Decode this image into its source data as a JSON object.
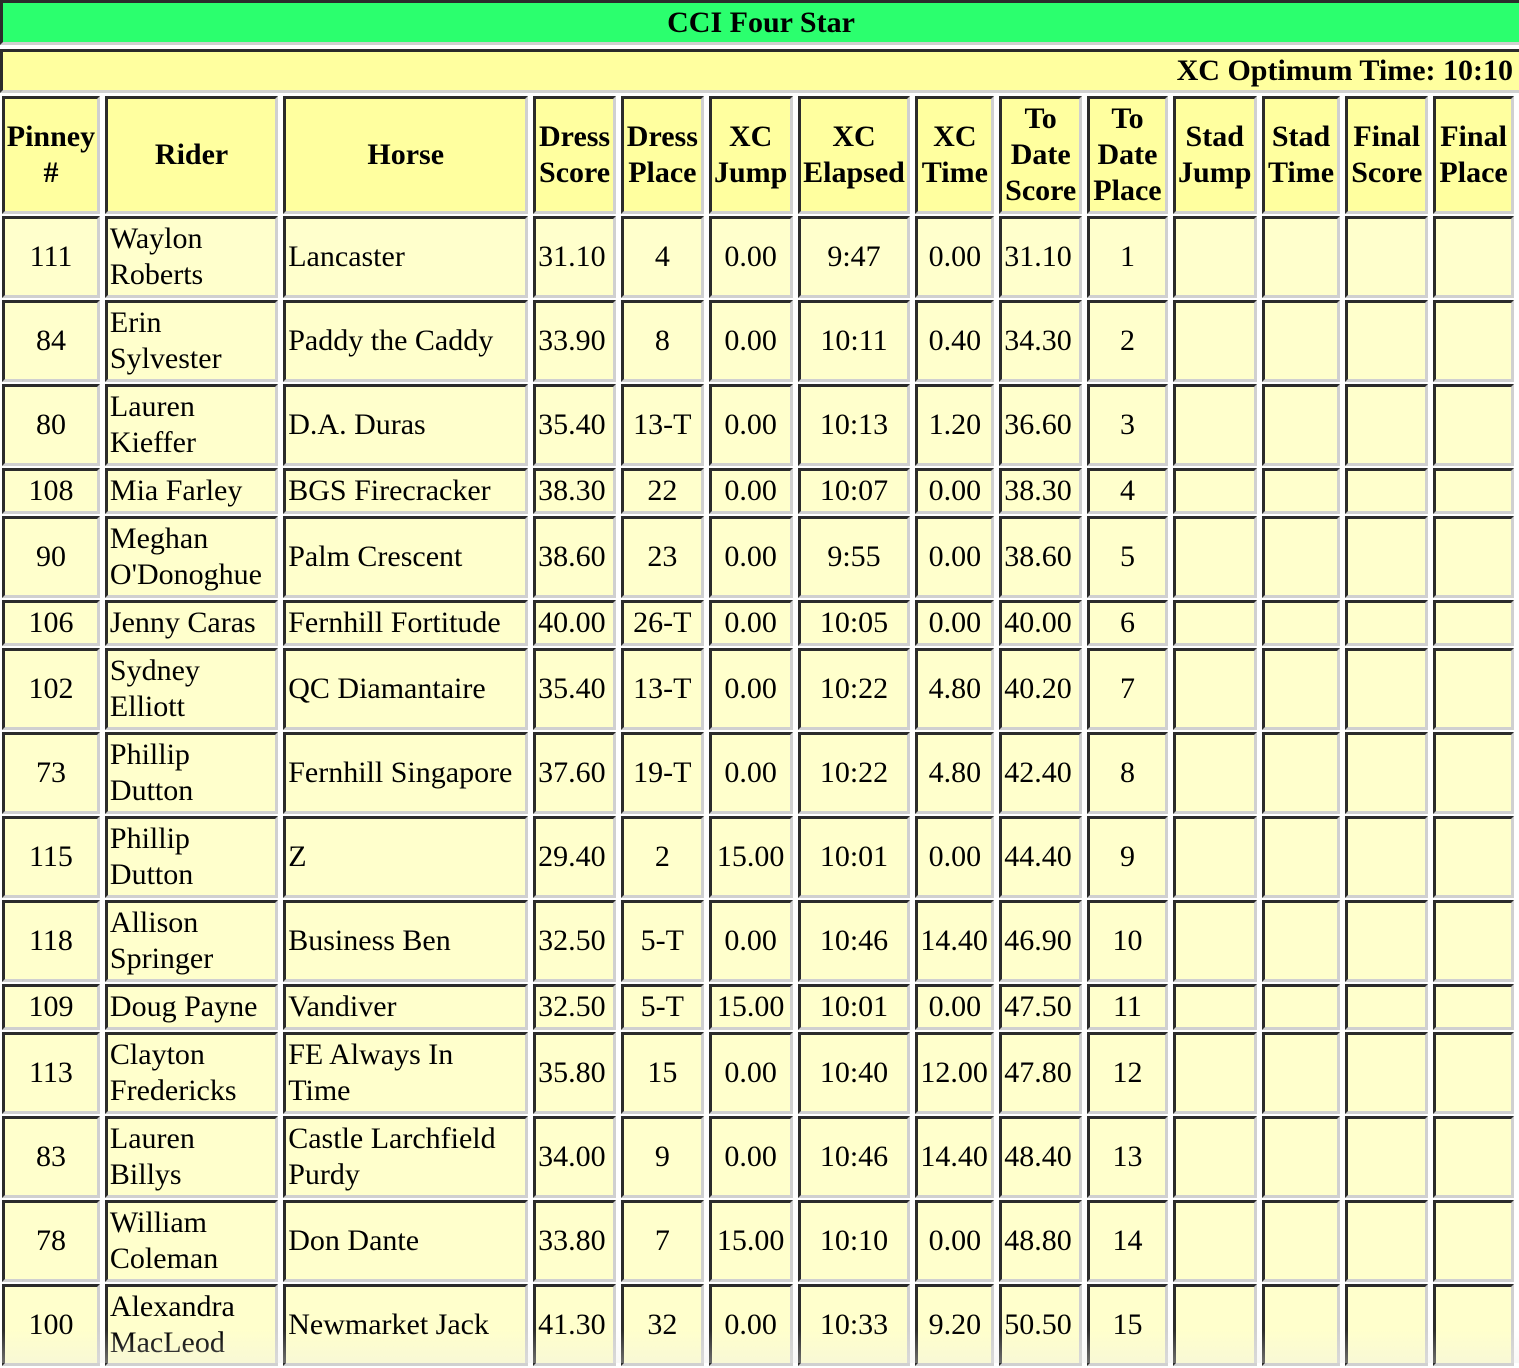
{
  "header": {
    "title": "CCI Four Star",
    "xc_optimum_time_label": "XC Optimum Time: 10:10"
  },
  "colors": {
    "title_bar": "#2bff6e",
    "header_cell": "#ffff9f",
    "data_cell": "#ffffcc"
  },
  "table": {
    "columns": [
      [
        "Pinney",
        "#"
      ],
      [
        "Rider"
      ],
      [
        "Horse"
      ],
      [
        "Dress",
        "Score"
      ],
      [
        "Dress",
        "Place"
      ],
      [
        "XC",
        "Jump"
      ],
      [
        "XC",
        "Elapsed"
      ],
      [
        "XC",
        "Time"
      ],
      [
        "To",
        "Date",
        "Score"
      ],
      [
        "To",
        "Date",
        "Place"
      ],
      [
        "Stad",
        "Jump"
      ],
      [
        "Stad",
        "Time"
      ],
      [
        "Final",
        "Score"
      ],
      [
        "Final",
        "Place"
      ]
    ],
    "rows": [
      {
        "pinney": "111",
        "rider": [
          "Waylon",
          "Roberts"
        ],
        "horse": [
          "Lancaster"
        ],
        "dress_score": "31.10",
        "dress_place": "4",
        "xc_jump": "0.00",
        "xc_elapsed": "9:47",
        "xc_time": "0.00",
        "to_date_score": "31.10",
        "to_date_place": "1",
        "stad_jump": "",
        "stad_time": "",
        "final_score": "",
        "final_place": ""
      },
      {
        "pinney": "84",
        "rider": [
          "Erin",
          "Sylvester"
        ],
        "horse": [
          "Paddy the Caddy"
        ],
        "dress_score": "33.90",
        "dress_place": "8",
        "xc_jump": "0.00",
        "xc_elapsed": "10:11",
        "xc_time": "0.40",
        "to_date_score": "34.30",
        "to_date_place": "2",
        "stad_jump": "",
        "stad_time": "",
        "final_score": "",
        "final_place": ""
      },
      {
        "pinney": "80",
        "rider": [
          "Lauren",
          "Kieffer"
        ],
        "horse": [
          "D.A. Duras"
        ],
        "dress_score": "35.40",
        "dress_place": "13-T",
        "xc_jump": "0.00",
        "xc_elapsed": "10:13",
        "xc_time": "1.20",
        "to_date_score": "36.60",
        "to_date_place": "3",
        "stad_jump": "",
        "stad_time": "",
        "final_score": "",
        "final_place": ""
      },
      {
        "pinney": "108",
        "rider": [
          "Mia Farley"
        ],
        "horse": [
          "BGS Firecracker"
        ],
        "dress_score": "38.30",
        "dress_place": "22",
        "xc_jump": "0.00",
        "xc_elapsed": "10:07",
        "xc_time": "0.00",
        "to_date_score": "38.30",
        "to_date_place": "4",
        "stad_jump": "",
        "stad_time": "",
        "final_score": "",
        "final_place": ""
      },
      {
        "pinney": "90",
        "rider": [
          "Meghan",
          "O'Donoghue"
        ],
        "horse": [
          "Palm Crescent"
        ],
        "dress_score": "38.60",
        "dress_place": "23",
        "xc_jump": "0.00",
        "xc_elapsed": "9:55",
        "xc_time": "0.00",
        "to_date_score": "38.60",
        "to_date_place": "5",
        "stad_jump": "",
        "stad_time": "",
        "final_score": "",
        "final_place": ""
      },
      {
        "pinney": "106",
        "rider": [
          "Jenny Caras"
        ],
        "horse": [
          "Fernhill Fortitude"
        ],
        "dress_score": "40.00",
        "dress_place": "26-T",
        "xc_jump": "0.00",
        "xc_elapsed": "10:05",
        "xc_time": "0.00",
        "to_date_score": "40.00",
        "to_date_place": "6",
        "stad_jump": "",
        "stad_time": "",
        "final_score": "",
        "final_place": ""
      },
      {
        "pinney": "102",
        "rider": [
          "Sydney",
          "Elliott"
        ],
        "horse": [
          "QC Diamantaire"
        ],
        "dress_score": "35.40",
        "dress_place": "13-T",
        "xc_jump": "0.00",
        "xc_elapsed": "10:22",
        "xc_time": "4.80",
        "to_date_score": "40.20",
        "to_date_place": "7",
        "stad_jump": "",
        "stad_time": "",
        "final_score": "",
        "final_place": ""
      },
      {
        "pinney": "73",
        "rider": [
          "Phillip",
          "Dutton"
        ],
        "horse": [
          "Fernhill Singapore"
        ],
        "dress_score": "37.60",
        "dress_place": "19-T",
        "xc_jump": "0.00",
        "xc_elapsed": "10:22",
        "xc_time": "4.80",
        "to_date_score": "42.40",
        "to_date_place": "8",
        "stad_jump": "",
        "stad_time": "",
        "final_score": "",
        "final_place": ""
      },
      {
        "pinney": "115",
        "rider": [
          "Phillip",
          "Dutton"
        ],
        "horse": [
          "Z"
        ],
        "dress_score": "29.40",
        "dress_place": "2",
        "xc_jump": "15.00",
        "xc_elapsed": "10:01",
        "xc_time": "0.00",
        "to_date_score": "44.40",
        "to_date_place": "9",
        "stad_jump": "",
        "stad_time": "",
        "final_score": "",
        "final_place": ""
      },
      {
        "pinney": "118",
        "rider": [
          "Allison",
          "Springer"
        ],
        "horse": [
          "Business Ben"
        ],
        "dress_score": "32.50",
        "dress_place": "5-T",
        "xc_jump": "0.00",
        "xc_elapsed": "10:46",
        "xc_time": "14.40",
        "to_date_score": "46.90",
        "to_date_place": "10",
        "stad_jump": "",
        "stad_time": "",
        "final_score": "",
        "final_place": ""
      },
      {
        "pinney": "109",
        "rider": [
          "Doug Payne"
        ],
        "horse": [
          "Vandiver"
        ],
        "dress_score": "32.50",
        "dress_place": "5-T",
        "xc_jump": "15.00",
        "xc_elapsed": "10:01",
        "xc_time": "0.00",
        "to_date_score": "47.50",
        "to_date_place": "11",
        "stad_jump": "",
        "stad_time": "",
        "final_score": "",
        "final_place": ""
      },
      {
        "pinney": "113",
        "rider": [
          "Clayton",
          "Fredericks"
        ],
        "horse": [
          "FE Always In",
          "Time"
        ],
        "dress_score": "35.80",
        "dress_place": "15",
        "xc_jump": "0.00",
        "xc_elapsed": "10:40",
        "xc_time": "12.00",
        "to_date_score": "47.80",
        "to_date_place": "12",
        "stad_jump": "",
        "stad_time": "",
        "final_score": "",
        "final_place": ""
      },
      {
        "pinney": "83",
        "rider": [
          "Lauren",
          "Billys"
        ],
        "horse": [
          "Castle Larchfield",
          "Purdy"
        ],
        "dress_score": "34.00",
        "dress_place": "9",
        "xc_jump": "0.00",
        "xc_elapsed": "10:46",
        "xc_time": "14.40",
        "to_date_score": "48.40",
        "to_date_place": "13",
        "stad_jump": "",
        "stad_time": "",
        "final_score": "",
        "final_place": ""
      },
      {
        "pinney": "78",
        "rider": [
          "William",
          "Coleman"
        ],
        "horse": [
          "Don Dante"
        ],
        "dress_score": "33.80",
        "dress_place": "7",
        "xc_jump": "15.00",
        "xc_elapsed": "10:10",
        "xc_time": "0.00",
        "to_date_score": "48.80",
        "to_date_place": "14",
        "stad_jump": "",
        "stad_time": "",
        "final_score": "",
        "final_place": ""
      },
      {
        "pinney": "100",
        "rider": [
          "Alexandra",
          "MacLeod"
        ],
        "horse": [
          "Newmarket Jack"
        ],
        "dress_score": "41.30",
        "dress_place": "32",
        "xc_jump": "0.00",
        "xc_elapsed": "10:33",
        "xc_time": "9.20",
        "to_date_score": "50.50",
        "to_date_place": "15",
        "stad_jump": "",
        "stad_time": "",
        "final_score": "",
        "final_place": ""
      }
    ]
  }
}
